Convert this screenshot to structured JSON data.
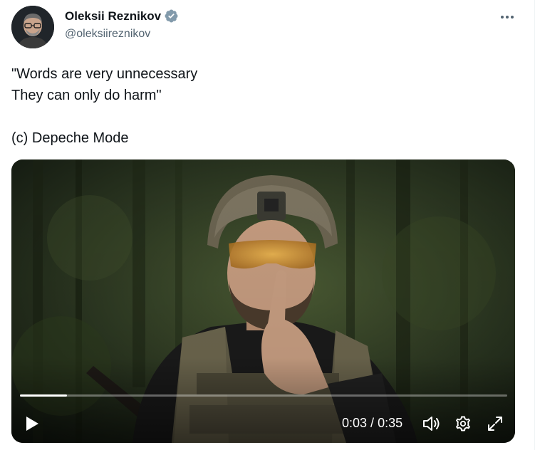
{
  "author": {
    "name": "Oleksii Reznikov",
    "handle": "@oleksiireznikov",
    "verified": true
  },
  "tweet": {
    "lines": [
      "\"Words are very unnecessary",
      "They can only do harm\"",
      "",
      "(c) Depeche Mode"
    ]
  },
  "video": {
    "current_time": "0:03",
    "separator": " / ",
    "duration": "0:35",
    "progress_fraction": 0.097
  },
  "icons": {
    "more": "more-horizontal-icon",
    "verified": "verified-badge-icon",
    "play": "play-icon",
    "volume": "volume-icon",
    "settings": "gear-icon",
    "fullscreen": "fullscreen-icon"
  },
  "colors": {
    "text": "#0f1419",
    "secondary": "#536471",
    "verified_badge": "#829aab",
    "video_control": "#ffffff"
  }
}
